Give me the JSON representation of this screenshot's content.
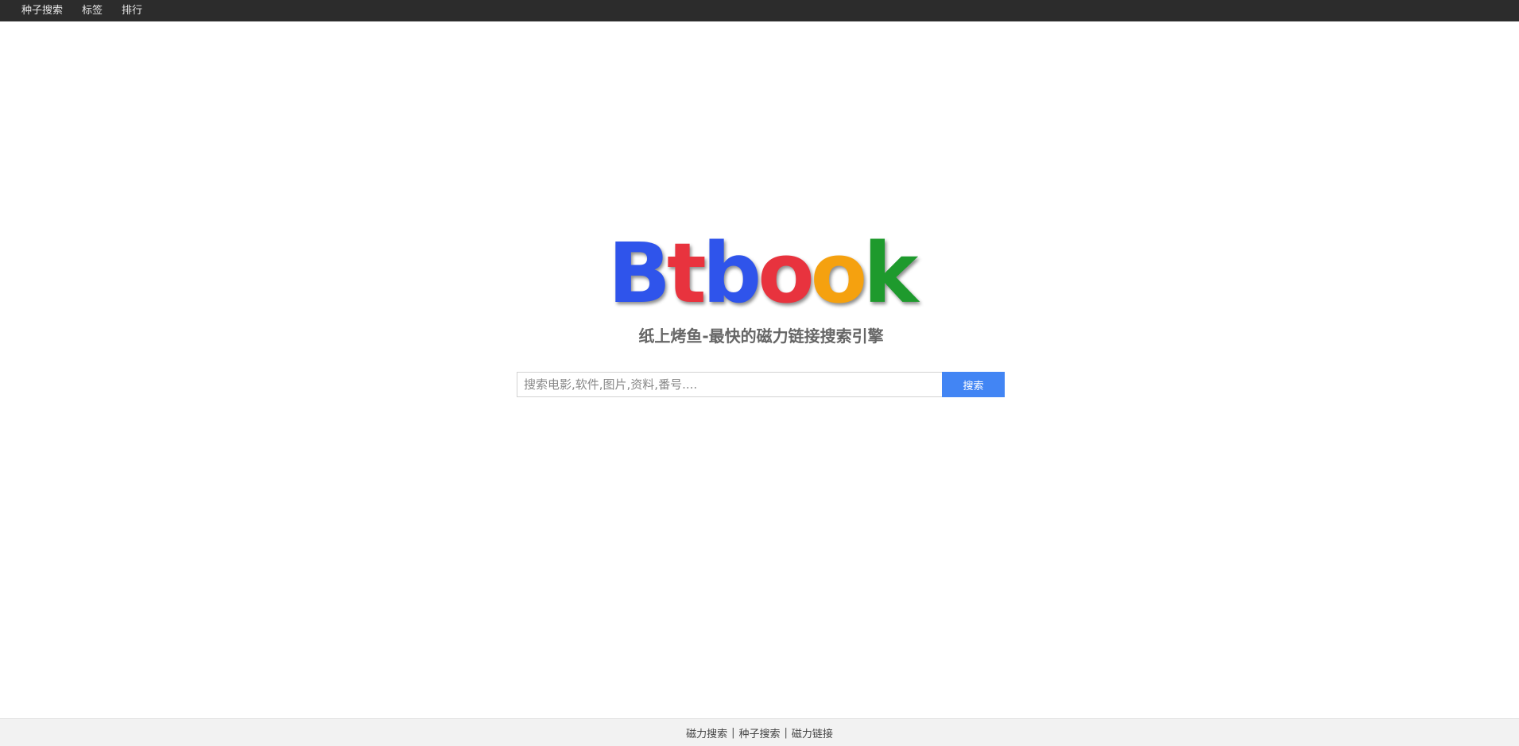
{
  "nav": {
    "items": [
      {
        "label": "种子搜索"
      },
      {
        "label": "标签"
      },
      {
        "label": "排行"
      }
    ]
  },
  "logo": {
    "text": "Btbook",
    "letters": [
      {
        "char": "B",
        "color": "#2f54eb"
      },
      {
        "char": "t",
        "color": "#e8333e"
      },
      {
        "char": "b",
        "color": "#2f54eb"
      },
      {
        "char": "o",
        "color": "#e8333e"
      },
      {
        "char": "o",
        "color": "#f5a10f"
      },
      {
        "char": "k",
        "color": "#1e9a2d"
      }
    ]
  },
  "subtitle": "纸上烤鱼-最快的磁力链接搜索引擎",
  "search": {
    "placeholder": "搜索电影,软件,图片,资料,番号....",
    "value": "",
    "button_label": "搜索"
  },
  "footer": {
    "links": [
      {
        "label": "磁力搜索"
      },
      {
        "label": "种子搜索"
      },
      {
        "label": "磁力链接"
      }
    ],
    "separator": "|"
  },
  "colors": {
    "topbar_bg": "#2c2c2c",
    "accent": "#4285f4",
    "footer_bg": "#f2f2f2"
  }
}
